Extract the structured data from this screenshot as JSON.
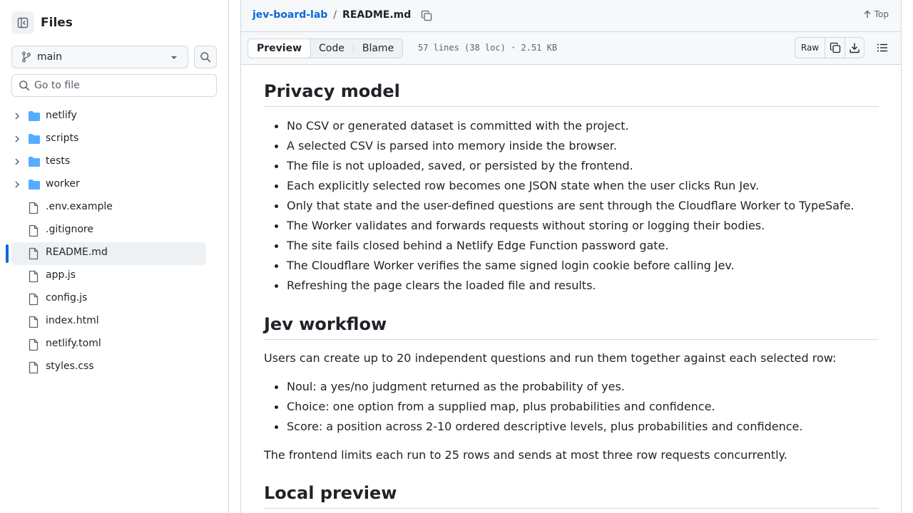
{
  "sidebar": {
    "title": "Files",
    "branch": "main",
    "goto_placeholder": "Go to file",
    "folders": [
      {
        "name": "netlify"
      },
      {
        "name": "scripts"
      },
      {
        "name": "tests"
      },
      {
        "name": "worker"
      }
    ],
    "files": [
      {
        "name": ".env.example"
      },
      {
        "name": ".gitignore"
      },
      {
        "name": "README.md",
        "active": true
      },
      {
        "name": "app.js"
      },
      {
        "name": "config.js"
      },
      {
        "name": "index.html"
      },
      {
        "name": "netlify.toml"
      },
      {
        "name": "styles.css"
      }
    ]
  },
  "header": {
    "repo": "jev-board-lab",
    "separator": "/",
    "file": "README.md",
    "top_label": "Top"
  },
  "toolbar": {
    "tabs": [
      "Preview",
      "Code",
      "Blame"
    ],
    "active_tab": "Preview",
    "meta": "57 lines (38 loc) · 2.51 KB",
    "raw_label": "Raw"
  },
  "readme": {
    "privacy_heading": "Privacy model",
    "privacy_items": [
      "No CSV or generated dataset is committed with the project.",
      "A selected CSV is parsed into memory inside the browser.",
      "The file is not uploaded, saved, or persisted by the frontend.",
      "Each explicitly selected row becomes one JSON state when the user clicks Run Jev.",
      "Only that state and the user-defined questions are sent through the Cloudflare Worker to TypeSafe.",
      "The Worker validates and forwards requests without storing or logging their bodies.",
      "The site fails closed behind a Netlify Edge Function password gate.",
      "The Cloudflare Worker verifies the same signed login cookie before calling Jev.",
      "Refreshing the page clears the loaded file and results."
    ],
    "workflow_heading": "Jev workflow",
    "workflow_intro": "Users can create up to 20 independent questions and run them together against each selected row:",
    "workflow_items": [
      "Noul: a yes/no judgment returned as the probability of yes.",
      "Choice: one option from a supplied map, plus probabilities and confidence.",
      "Score: a position across 2-10 ordered descriptive levels, plus probabilities and confidence."
    ],
    "workflow_outro": "The frontend limits each run to 25 rows and sends at most three row requests concurrently.",
    "preview_heading": "Local preview"
  },
  "colors": {
    "accent": "#0969da",
    "folder": "#54aeff",
    "border": "#d1d9e0",
    "muted": "#59636e"
  }
}
